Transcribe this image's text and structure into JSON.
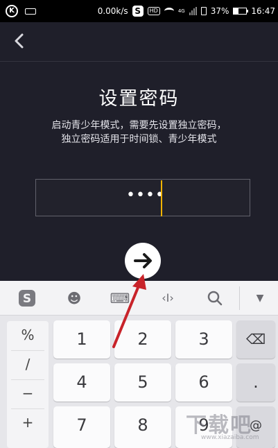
{
  "status_bar": {
    "carrier_icon": "K",
    "speed": "0.00k/s",
    "app_icon": "S",
    "hd": "HD",
    "network": "4G",
    "battery": "37%",
    "time": "16:47"
  },
  "header": {
    "back_icon": "chevron-left-icon"
  },
  "main": {
    "title": "设置密码",
    "desc_line1": "启动青少年模式，需要先设置独立密码，",
    "desc_line2": "独立密码适用于时间锁、青少年模式",
    "password_mask": "••••",
    "next_icon": "arrow-right-icon"
  },
  "keyboard": {
    "toolbar": {
      "logo": "S",
      "emoji": "☻",
      "keyboard": "⌨",
      "cursor": "‹I›",
      "search": "⚲",
      "collapse": "▼"
    },
    "symbols": [
      "%",
      "/",
      "−",
      "+"
    ],
    "digits": [
      "1",
      "2",
      "3",
      "4",
      "5",
      "6",
      "7",
      "8",
      "9"
    ],
    "delete": "⌫",
    "dot": ".",
    "at": "@"
  },
  "watermark": {
    "main": "下载吧",
    "sub": "www.xiazaiba.com"
  },
  "colors": {
    "background": "#1f1f2a",
    "cursor": "#f1b300",
    "annotation": "#c8232a"
  }
}
